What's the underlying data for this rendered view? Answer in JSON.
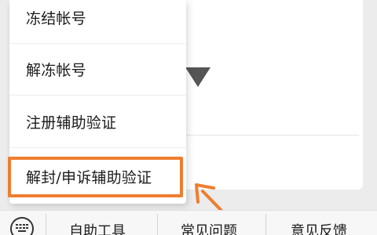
{
  "menu": {
    "items": [
      {
        "label": "冻结帐号"
      },
      {
        "label": "解冻帐号"
      },
      {
        "label": "注册辅助验证"
      },
      {
        "label": "解封/申诉辅助验证"
      }
    ]
  },
  "bottom_bar": {
    "items": [
      {
        "label": "自助工具"
      },
      {
        "label": "常见问题"
      },
      {
        "label": "意见反馈"
      }
    ],
    "keyboard_icon": "keyboard-icon"
  },
  "annotation": {
    "highlight_color": "#ef7d2f"
  }
}
